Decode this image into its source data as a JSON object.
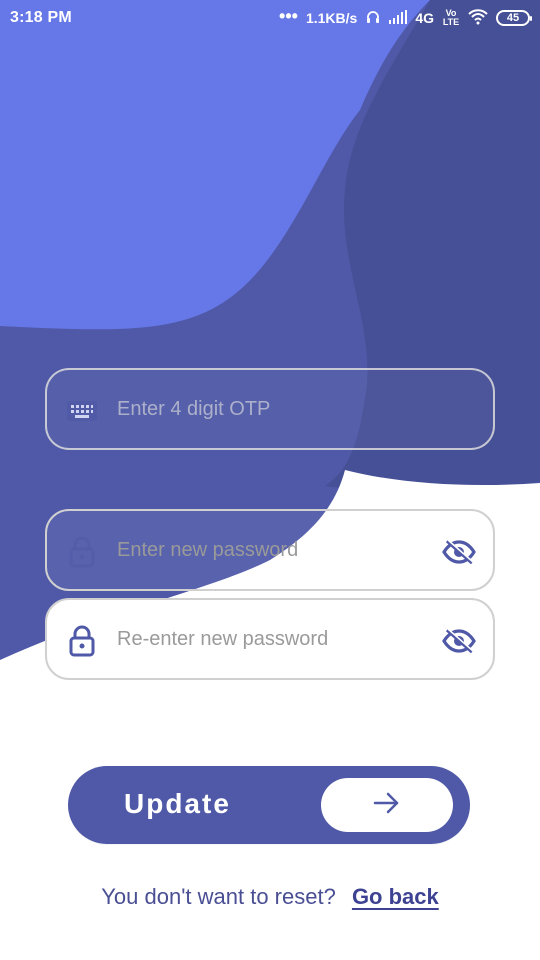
{
  "status_bar": {
    "time": "3:18 PM",
    "dots": "•••",
    "network_speed": "1.1KB/s",
    "network": "4G",
    "volte": "Vo LTE",
    "battery": "45"
  },
  "form": {
    "otp_placeholder": "Enter 4 digit OTP",
    "new_password_placeholder": "Enter new password",
    "reenter_password_placeholder": "Re-enter new password"
  },
  "update": {
    "label": "Update"
  },
  "footer": {
    "question": "You don't want to reset?",
    "link": "Go back"
  },
  "theme": {
    "primary": "#4f59a7",
    "secondary": "#6678e8",
    "text": "#4a4f94"
  },
  "icons": {
    "otp": "keyboard-icon",
    "new_password": "lock-icon",
    "reenter_password": "lock-icon",
    "visibility_toggle": "eye-off-icon",
    "arrow": "arrow-right-icon"
  }
}
